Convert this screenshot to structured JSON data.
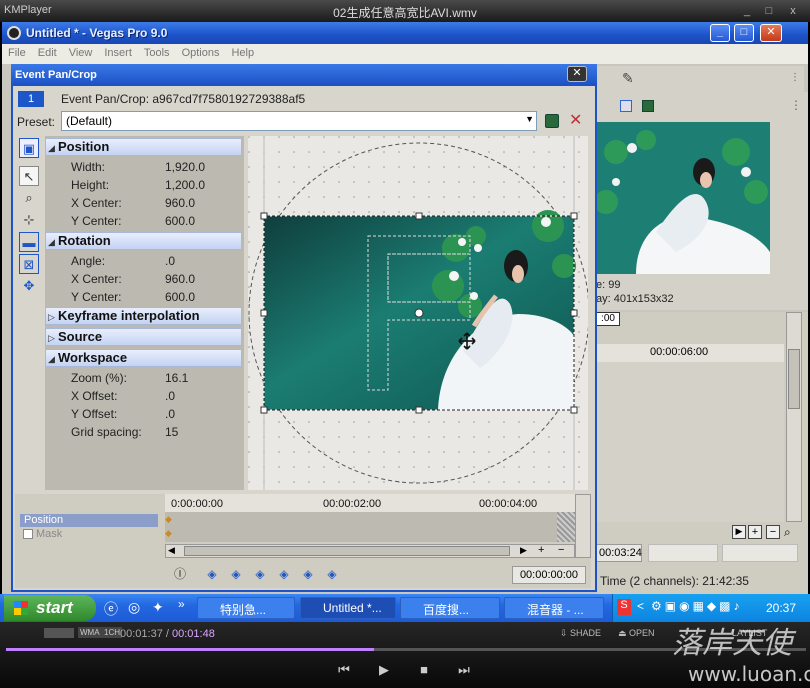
{
  "km": {
    "app": "KMPlayer",
    "file": "02生成任意高宽比AVI.wmv",
    "min": "_",
    "max": "□",
    "close": "x"
  },
  "vegas": {
    "title": "Untitled * - Vegas Pro 9.0",
    "menu": [
      "File",
      "Edit",
      "View",
      "Insert",
      "Tools",
      "Options",
      "Help"
    ],
    "info_line1": "e:  99",
    "info_line2": "ay:  401x153x32",
    "time1": "00:00:06:00",
    "time_box": ":00",
    "time_status": "00:03:24",
    "audio_status": "Time (2 channels): 21:42:35"
  },
  "dialog": {
    "title": "Event Pan/Crop",
    "event_num": "1",
    "event_label": "Event Pan/Crop: a967cd7f7580192729388af5",
    "preset_label": "Preset:",
    "preset_value": "(Default)",
    "sections": [
      {
        "name": "Position",
        "expanded": true,
        "rows": [
          [
            "Width:",
            "1,920.0"
          ],
          [
            "Height:",
            "1,200.0"
          ],
          [
            "X Center:",
            "960.0"
          ],
          [
            "Y Center:",
            "600.0"
          ]
        ]
      },
      {
        "name": "Rotation",
        "expanded": true,
        "rows": [
          [
            "Angle:",
            ".0"
          ],
          [
            "X Center:",
            "960.0"
          ],
          [
            "Y Center:",
            "600.0"
          ]
        ]
      },
      {
        "name": "Keyframe interpolation",
        "expanded": false,
        "rows": []
      },
      {
        "name": "Source",
        "expanded": false,
        "rows": []
      },
      {
        "name": "Workspace",
        "expanded": true,
        "rows": [
          [
            "Zoom (%):",
            "16.1"
          ],
          [
            "X Offset:",
            ".0"
          ],
          [
            "Y Offset:",
            ".0"
          ],
          [
            "Grid spacing:",
            "15"
          ]
        ]
      }
    ],
    "ruler": [
      "0:00:00:00",
      "00:00:02:00",
      "00:00:04:00"
    ],
    "track_position": "Position",
    "track_mask": "Mask",
    "cursor_time": "00:00:00:00"
  },
  "taskbar": {
    "start": "start",
    "items": [
      "特别急...",
      "Untitled *...",
      "百度搜...",
      "混音器 - ..."
    ],
    "clock": "20:37"
  },
  "player": {
    "elapsed": "00:01:37",
    "total": "00:01:48",
    "tags": [
      "WMA",
      "1CH"
    ],
    "right_labels": [
      "SHADE",
      "OPEN",
      "LAYLIST"
    ],
    "progress": 0.46
  },
  "watermark": {
    "line1": "落岸天使",
    "line2": "www.luoan.cn"
  }
}
